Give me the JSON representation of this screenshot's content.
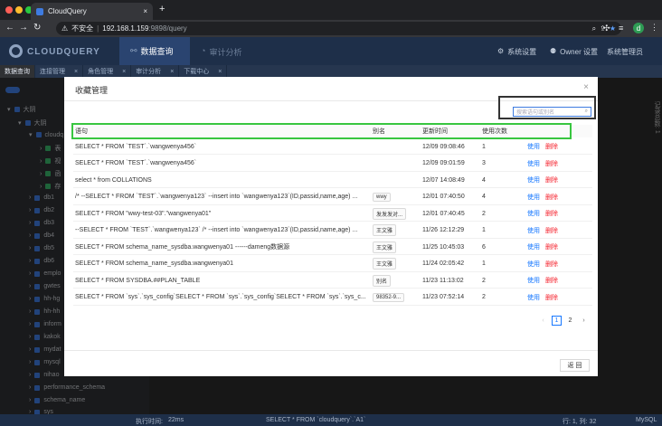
{
  "browser": {
    "tab_title": "CloudQuery",
    "new_tab": "+",
    "url_warning": "不安全",
    "url_host": "192.168.1.159",
    "url_path": ":9898/query",
    "profile": "d"
  },
  "app": {
    "logo": "CLOUDQUERY",
    "nav": [
      "数据查询",
      "审计分析"
    ],
    "right": [
      "系统设置",
      "Owner 设置",
      "系统管理员"
    ]
  },
  "work_tabs": [
    "数据查询",
    "连接管理",
    "角色管理",
    "审计分析",
    "下载中心"
  ],
  "tree": [
    "大阴",
    "大阴",
    "cloudq",
    "表",
    "视",
    "函",
    "存",
    "db1",
    "db2",
    "db3",
    "db4",
    "db5",
    "db6",
    "emplo",
    "gwtes",
    "hh-hg",
    "hh-hh",
    "inform",
    "kakok",
    "mydat",
    "mysql",
    "nihao",
    "performance_schema",
    "schema_name",
    "sys"
  ],
  "status": {
    "exec": "执行时间:",
    "time": "22ms",
    "sql": "SELECT * FROM `cloudquery`.`A1`",
    "pos": "行: 1, 列: 32",
    "db": "MySQL"
  },
  "modal": {
    "title": "收藏管理",
    "close": "×",
    "search_placeholder": "搜索语句或别名",
    "columns": [
      "语句",
      "别名",
      "更新时间",
      "使用次数"
    ],
    "rows": [
      {
        "sql": "SELECT * FROM `TEST`.`wangwenya456`",
        "alias": "",
        "time": "12/09 09:08:46",
        "count": "1"
      },
      {
        "sql": "SELECT * FROM `TEST`.`wangwenya456`",
        "alias": "",
        "time": "12/09 09:01:59",
        "count": "3"
      },
      {
        "sql": "select * from COLLATIONS",
        "alias": "",
        "time": "12/07 14:08:49",
        "count": "4"
      },
      {
        "sql": "/* --SELECT * FROM `TEST`.`wangwenya123` --insert into `wangwenya123`(ID,passid,name,age) ...",
        "alias": "wwy",
        "time": "12/01 07:40:50",
        "count": "4"
      },
      {
        "sql": "SELECT * FROM \"wwy-test-03\".\"wangwenya01\"",
        "alias": "发发发对...",
        "time": "12/01 07:40:45",
        "count": "2"
      },
      {
        "sql": "--SELECT * FROM `TEST`.`wangwenya123` /* --insert into `wangwenya123`(ID,passid,name,age) ...",
        "alias": "王文雅",
        "time": "11/26 12:12:29",
        "count": "1"
      },
      {
        "sql": "SELECT * FROM schema_name_sysdba.wangwenya01 ------dameng数据源",
        "alias": "王文雅",
        "time": "11/25 10:45:03",
        "count": "6"
      },
      {
        "sql": "SELECT * FROM schema_name_sysdba.wangwenya01",
        "alias": "王文雅",
        "time": "11/24 02:05:42",
        "count": "1"
      },
      {
        "sql": "SELECT * FROM SYSDBA.##PLAN_TABLE",
        "alias": "别名",
        "time": "11/23 11:13:02",
        "count": "2"
      },
      {
        "sql": "SELECT * FROM `sys`.`sys_config`SELECT * FROM `sys`.`sys_config`SELECT * FROM `sys`.`sys_c...",
        "alias": "98352-9...",
        "time": "11/23 07:52:14",
        "count": "2"
      }
    ],
    "use_label": "使用",
    "delete_label": "删除",
    "pages": [
      "1",
      "2"
    ],
    "back": "返 回"
  },
  "right_panel": "记录总数: 1"
}
